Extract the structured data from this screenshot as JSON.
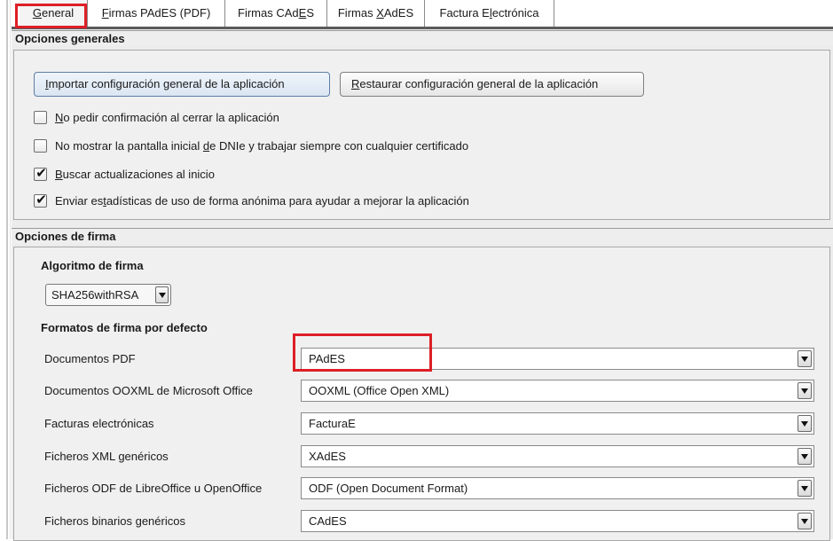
{
  "tabs": [
    {
      "pre": "",
      "mnemonic": "G",
      "post": "eneral"
    },
    {
      "pre": "",
      "mnemonic": "F",
      "post": "irmas PAdES (PDF)"
    },
    {
      "pre": "Firmas CAd",
      "mnemonic": "E",
      "post": "S"
    },
    {
      "pre": "Firmas ",
      "mnemonic": "X",
      "post": "AdES"
    },
    {
      "pre": "Factura E",
      "mnemonic": "l",
      "post": "ectrónica"
    }
  ],
  "general_options": {
    "title": "Opciones generales",
    "import_button": {
      "pre": "",
      "mnemonic": "I",
      "post": "mportar configuración general de la aplicación"
    },
    "restore_button": {
      "pre": "",
      "mnemonic": "R",
      "post": "estaurar configuración general de la aplicación"
    },
    "checkboxes": [
      {
        "pre": "",
        "mnemonic": "N",
        "post": "o pedir confirmación al cerrar la aplicación",
        "checked": false
      },
      {
        "pre": "No mostrar la pantalla inicial ",
        "mnemonic": "d",
        "post": "e DNIe y trabajar siempre con cualquier certificado",
        "checked": false
      },
      {
        "pre": "",
        "mnemonic": "B",
        "post": "uscar actualizaciones al inicio",
        "checked": true
      },
      {
        "pre": "Enviar es",
        "mnemonic": "t",
        "post": "adísticas de uso de forma anónima para ayudar a mejorar la aplicación",
        "checked": true
      }
    ],
    "check_glyph": "✔"
  },
  "signature_options": {
    "title": "Opciones de firma",
    "algorithm_heading": "Algoritmo de firma",
    "algorithm_value": "SHA256withRSA",
    "formats_heading": "Formatos de firma por defecto",
    "formats": [
      {
        "label": "Documentos PDF",
        "value": "PAdES"
      },
      {
        "label": "Documentos OOXML de Microsoft Office",
        "value": "OOXML (Office Open XML)"
      },
      {
        "label": "Facturas electrónicas",
        "value": "FacturaE"
      },
      {
        "label": "Ficheros XML genéricos",
        "value": "XAdES"
      },
      {
        "label": "Ficheros ODF de LibreOffice u OpenOffice",
        "value": "ODF (Open Document Format)"
      },
      {
        "label": "Ficheros binarios genéricos",
        "value": "CAdES"
      }
    ]
  },
  "colors": {
    "highlight_box": "#dd1f26",
    "panel_bg": "#ececec"
  },
  "icons": {
    "dropdown": "chevron-down-icon",
    "checkbox": "check-icon"
  }
}
